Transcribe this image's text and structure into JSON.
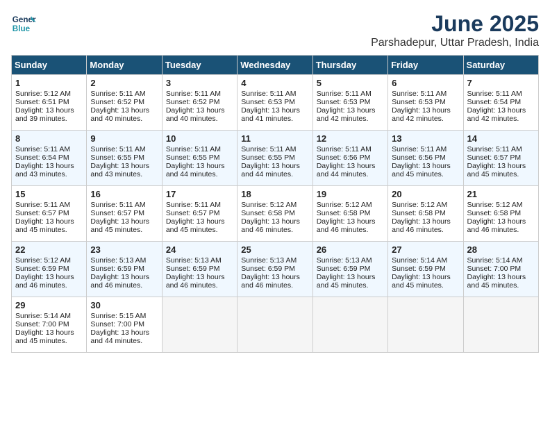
{
  "header": {
    "logo_line1": "General",
    "logo_line2": "Blue",
    "month": "June 2025",
    "location": "Parshadepur, Uttar Pradesh, India"
  },
  "weekdays": [
    "Sunday",
    "Monday",
    "Tuesday",
    "Wednesday",
    "Thursday",
    "Friday",
    "Saturday"
  ],
  "weeks": [
    [
      {
        "day": "1",
        "sunrise": "5:12 AM",
        "sunset": "6:51 PM",
        "daylight": "13 hours and 39 minutes."
      },
      {
        "day": "2",
        "sunrise": "5:11 AM",
        "sunset": "6:52 PM",
        "daylight": "13 hours and 40 minutes."
      },
      {
        "day": "3",
        "sunrise": "5:11 AM",
        "sunset": "6:52 PM",
        "daylight": "13 hours and 40 minutes."
      },
      {
        "day": "4",
        "sunrise": "5:11 AM",
        "sunset": "6:53 PM",
        "daylight": "13 hours and 41 minutes."
      },
      {
        "day": "5",
        "sunrise": "5:11 AM",
        "sunset": "6:53 PM",
        "daylight": "13 hours and 42 minutes."
      },
      {
        "day": "6",
        "sunrise": "5:11 AM",
        "sunset": "6:53 PM",
        "daylight": "13 hours and 42 minutes."
      },
      {
        "day": "7",
        "sunrise": "5:11 AM",
        "sunset": "6:54 PM",
        "daylight": "13 hours and 42 minutes."
      }
    ],
    [
      {
        "day": "8",
        "sunrise": "5:11 AM",
        "sunset": "6:54 PM",
        "daylight": "13 hours and 43 minutes."
      },
      {
        "day": "9",
        "sunrise": "5:11 AM",
        "sunset": "6:55 PM",
        "daylight": "13 hours and 43 minutes."
      },
      {
        "day": "10",
        "sunrise": "5:11 AM",
        "sunset": "6:55 PM",
        "daylight": "13 hours and 44 minutes."
      },
      {
        "day": "11",
        "sunrise": "5:11 AM",
        "sunset": "6:55 PM",
        "daylight": "13 hours and 44 minutes."
      },
      {
        "day": "12",
        "sunrise": "5:11 AM",
        "sunset": "6:56 PM",
        "daylight": "13 hours and 44 minutes."
      },
      {
        "day": "13",
        "sunrise": "5:11 AM",
        "sunset": "6:56 PM",
        "daylight": "13 hours and 45 minutes."
      },
      {
        "day": "14",
        "sunrise": "5:11 AM",
        "sunset": "6:57 PM",
        "daylight": "13 hours and 45 minutes."
      }
    ],
    [
      {
        "day": "15",
        "sunrise": "5:11 AM",
        "sunset": "6:57 PM",
        "daylight": "13 hours and 45 minutes."
      },
      {
        "day": "16",
        "sunrise": "5:11 AM",
        "sunset": "6:57 PM",
        "daylight": "13 hours and 45 minutes."
      },
      {
        "day": "17",
        "sunrise": "5:11 AM",
        "sunset": "6:57 PM",
        "daylight": "13 hours and 45 minutes."
      },
      {
        "day": "18",
        "sunrise": "5:12 AM",
        "sunset": "6:58 PM",
        "daylight": "13 hours and 46 minutes."
      },
      {
        "day": "19",
        "sunrise": "5:12 AM",
        "sunset": "6:58 PM",
        "daylight": "13 hours and 46 minutes."
      },
      {
        "day": "20",
        "sunrise": "5:12 AM",
        "sunset": "6:58 PM",
        "daylight": "13 hours and 46 minutes."
      },
      {
        "day": "21",
        "sunrise": "5:12 AM",
        "sunset": "6:58 PM",
        "daylight": "13 hours and 46 minutes."
      }
    ],
    [
      {
        "day": "22",
        "sunrise": "5:12 AM",
        "sunset": "6:59 PM",
        "daylight": "13 hours and 46 minutes."
      },
      {
        "day": "23",
        "sunrise": "5:13 AM",
        "sunset": "6:59 PM",
        "daylight": "13 hours and 46 minutes."
      },
      {
        "day": "24",
        "sunrise": "5:13 AM",
        "sunset": "6:59 PM",
        "daylight": "13 hours and 46 minutes."
      },
      {
        "day": "25",
        "sunrise": "5:13 AM",
        "sunset": "6:59 PM",
        "daylight": "13 hours and 46 minutes."
      },
      {
        "day": "26",
        "sunrise": "5:13 AM",
        "sunset": "6:59 PM",
        "daylight": "13 hours and 45 minutes."
      },
      {
        "day": "27",
        "sunrise": "5:14 AM",
        "sunset": "6:59 PM",
        "daylight": "13 hours and 45 minutes."
      },
      {
        "day": "28",
        "sunrise": "5:14 AM",
        "sunset": "7:00 PM",
        "daylight": "13 hours and 45 minutes."
      }
    ],
    [
      {
        "day": "29",
        "sunrise": "5:14 AM",
        "sunset": "7:00 PM",
        "daylight": "13 hours and 45 minutes."
      },
      {
        "day": "30",
        "sunrise": "5:15 AM",
        "sunset": "7:00 PM",
        "daylight": "13 hours and 44 minutes."
      },
      null,
      null,
      null,
      null,
      null
    ]
  ]
}
